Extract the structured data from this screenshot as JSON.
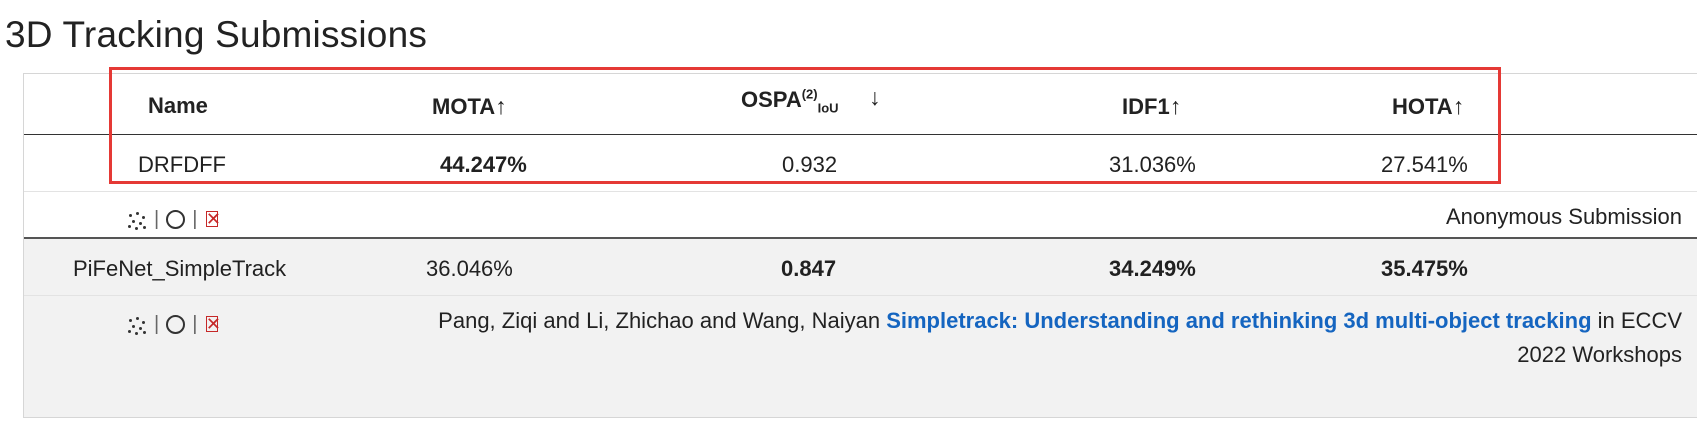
{
  "page_title": "3D Tracking Submissions",
  "table": {
    "headers": {
      "name": "Name",
      "mota": "MOTA",
      "mota_arrow": "↑",
      "ospa": "OSPA",
      "ospa_sup": "(2)",
      "ospa_sub": "IoU",
      "ospa_arrow": "↓",
      "idf1": "IDF1",
      "idf1_arrow": "↑",
      "hota": "HOTA",
      "hota_arrow": "↑"
    },
    "rows": [
      {
        "name": "DRFDFF",
        "mota": "44.247%",
        "ospa": "0.932",
        "idf1": "31.036%",
        "hota": "27.541%",
        "icon_sep_1": "|",
        "icon_sep_2": "|",
        "description": "Anonymous Submission"
      },
      {
        "name": "PiFeNet_SimpleTrack",
        "mota": "36.046%",
        "ospa": "0.847",
        "idf1": "34.249%",
        "hota": "35.475%",
        "icon_sep_1": "|",
        "icon_sep_2": "|",
        "citation_authors": "Pang, Ziqi and Li, Zhichao and Wang, Naiyan",
        "citation_title": "Simpletrack: Understanding and rethinking 3d multi-object tracking",
        "citation_venue_1": "in ECCV",
        "citation_venue_2": "2022 Workshops"
      }
    ]
  },
  "colors": {
    "link": "#1565c0",
    "highlight": "#e53935",
    "method_x": "#c62828",
    "alt_row": "#f2f2f2"
  },
  "icons": [
    "lidar-dots-icon",
    "circle-icon",
    "no-camera-icon"
  ]
}
